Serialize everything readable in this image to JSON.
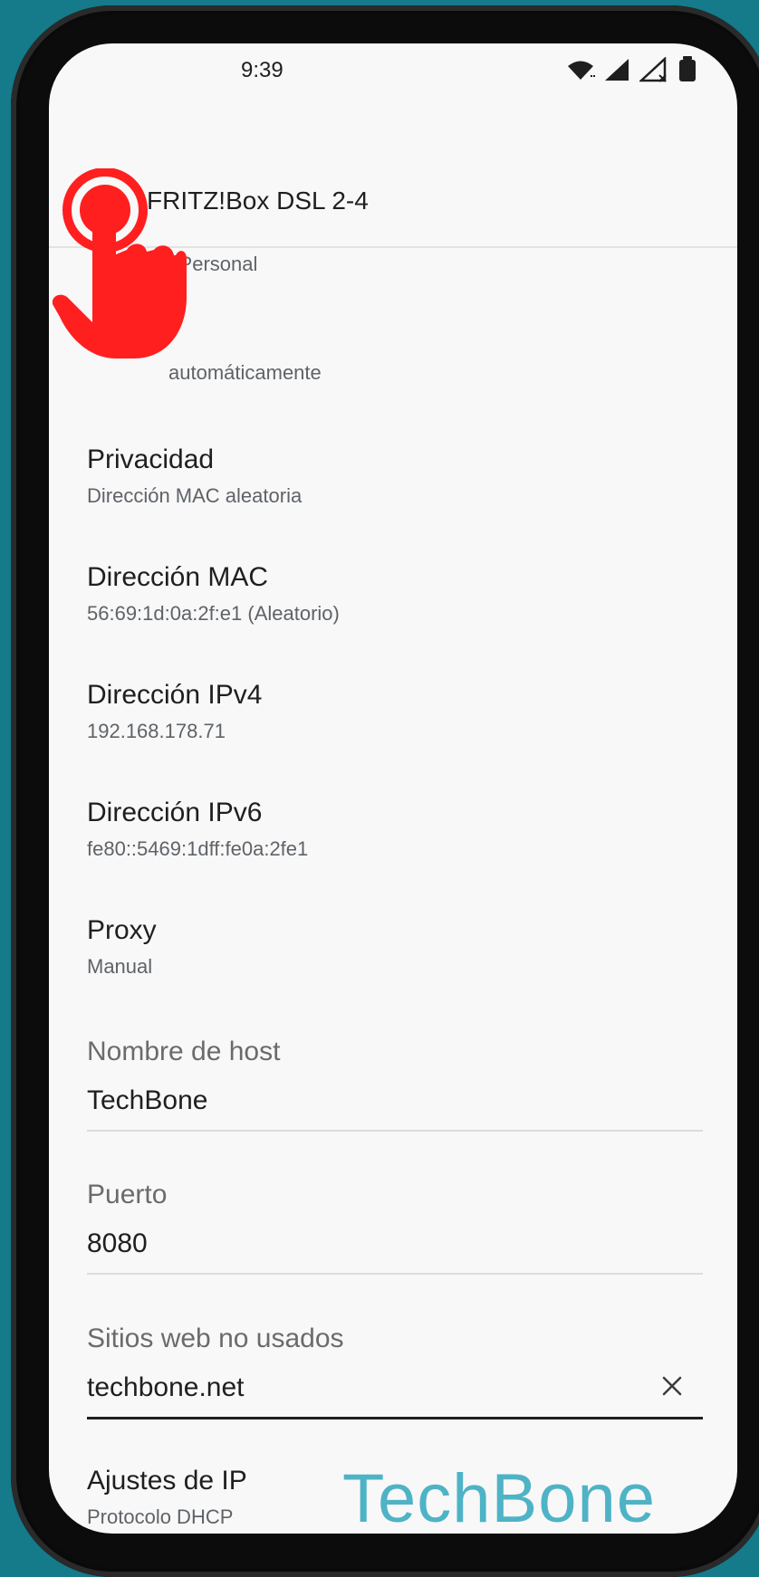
{
  "status": {
    "time": "9:39",
    "icons": [
      "wifi-icon",
      "signal-icon",
      "signal-x-icon",
      "battery-icon"
    ]
  },
  "header": {
    "title": "FRITZ!Box DSL 2-4"
  },
  "sections": {
    "security_partial": {
      "sub": "2-Personal"
    },
    "auto_partial": {
      "sub": "automáticamente"
    },
    "privacy": {
      "title": "Privacidad",
      "sub": "Dirección MAC aleatoria"
    },
    "mac": {
      "title": "Dirección MAC",
      "sub": "56:69:1d:0a:2f:e1 (Aleatorio)"
    },
    "ipv4": {
      "title": "Dirección IPv4",
      "sub": "192.168.178.71"
    },
    "ipv6": {
      "title": "Dirección IPv6",
      "sub": "fe80::5469:1dff:fe0a:2fe1"
    },
    "proxy": {
      "title": "Proxy",
      "sub": "Manual"
    },
    "host": {
      "label": "Nombre de host",
      "value": "TechBone"
    },
    "port": {
      "label": "Puerto",
      "value": "8080"
    },
    "bypass": {
      "label": "Sitios web no usados",
      "value": "techbone.net"
    },
    "ip_settings": {
      "title": "Ajustes de IP",
      "sub": "Protocolo DHCP"
    }
  },
  "watermark": {
    "text": "TechBone"
  },
  "colors": {
    "background": "#157a8a",
    "screen": "#f8f8f8",
    "accent": "#4fb3c6",
    "hand": "#ff1f1f"
  }
}
